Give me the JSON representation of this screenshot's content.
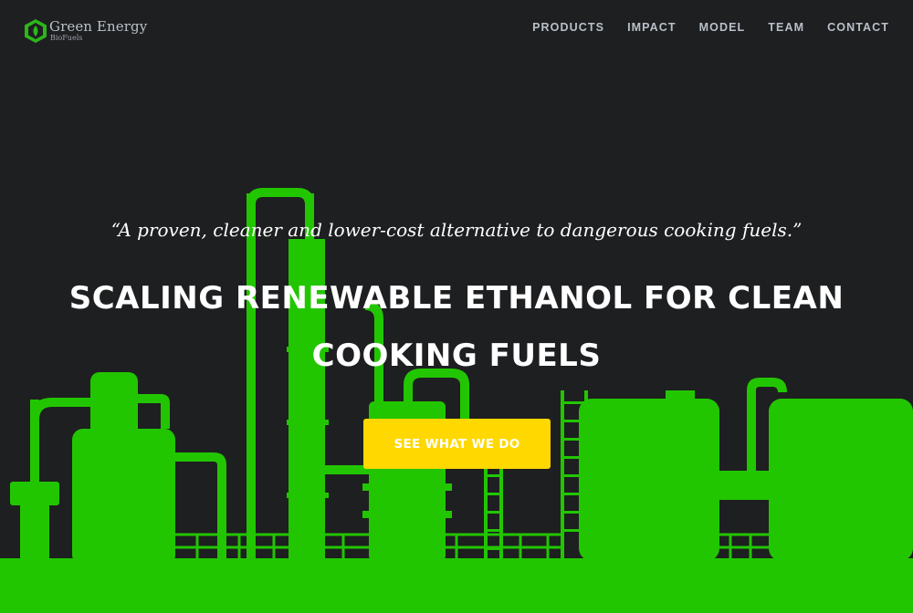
{
  "header": {
    "brand_name": "Green Energy",
    "brand_sub": "BioFuels",
    "nav": [
      "PRODUCTS",
      "IMPACT",
      "MODEL",
      "TEAM",
      "CONTACT"
    ]
  },
  "hero": {
    "quote": "“A proven, cleaner and lower-cost alternative to dangerous cooking fuels.”",
    "headline": "SCALING RENEWABLE ETHANOL FOR CLEAN COOKING FUELS",
    "cta_label": "SEE WHAT WE DO"
  },
  "colors": {
    "background": "#1e1f21",
    "refinery_green": "#22c600",
    "cta_yellow": "#ffd800",
    "nav_text": "#b9c0c8",
    "headline_text": "#ffffff",
    "logo_green": "#2db51b"
  },
  "icons": {
    "logo": "hexagon-leaf-icon"
  }
}
